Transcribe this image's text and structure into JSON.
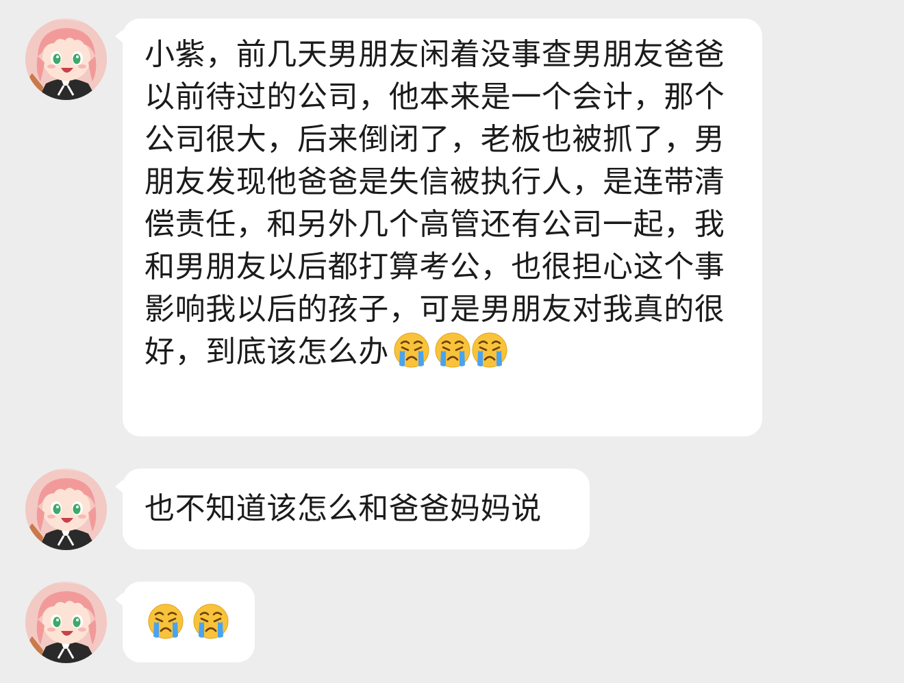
{
  "messages": [
    {
      "text": "小紫，前几天男朋友闲着没事查男朋友爸爸以前待过的公司，他本来是一个会计，那个公司很大，后来倒闭了，老板也被抓了，男朋友发现他爸爸是失信被执行人，是连带清偿责任，和另外几个高管还有公司一起，我和男朋友以后都打算考公，也很担心这个事影响我以后的孩子，可是男朋友对我真的很好，到底该怎么办",
      "emojis": [
        "loudly-crying-face-icon",
        "loudly-crying-face-icon",
        "loudly-crying-face-icon"
      ]
    },
    {
      "text": "也不知道该怎么和爸爸妈妈说",
      "emojis": []
    },
    {
      "text": "",
      "emojis": [
        "loudly-crying-face-icon",
        "loudly-crying-face-icon"
      ]
    }
  ],
  "colors": {
    "background": "#ededed",
    "bubble": "#ffffff",
    "text": "#1b1b1b",
    "avatar_hair": "#f29a9a",
    "emoji_face": "#f8c33a",
    "emoji_tears": "#4aa3f0"
  }
}
